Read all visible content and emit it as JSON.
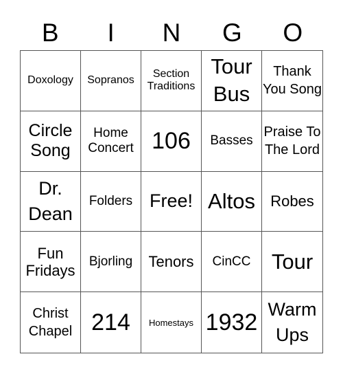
{
  "header": {
    "letters": [
      "B",
      "I",
      "N",
      "G",
      "O"
    ]
  },
  "cells": [
    [
      "Doxology",
      "Sopranos",
      "Section Traditions",
      "Tour Bus",
      "Thank You Song"
    ],
    [
      "Circle Song",
      "Home Concert",
      "106",
      "Basses",
      "Praise To The Lord"
    ],
    [
      "Dr. Dean",
      "Folders",
      "Free!",
      "Altos",
      "Robes"
    ],
    [
      "Fun Fridays",
      "Bjorling",
      "Tenors",
      "CinCC",
      "Tour"
    ],
    [
      "Christ Chapel",
      "214",
      "Homestays",
      "1932",
      "Warm Ups"
    ]
  ],
  "free_space": "Free!"
}
